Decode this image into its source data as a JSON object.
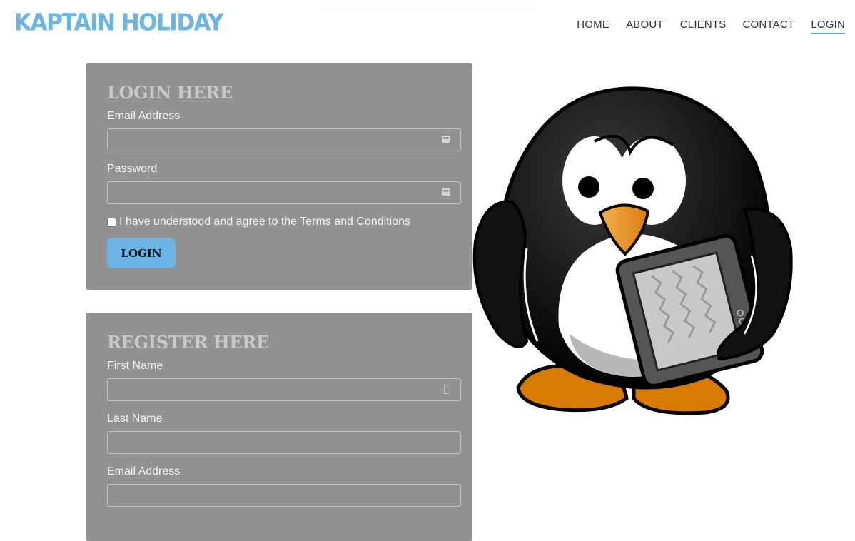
{
  "brand": {
    "logo_text": "KAPTAIN HOLIDAY",
    "accent_color": "#6cb4e4",
    "panel_color": "#929292"
  },
  "nav": {
    "items": [
      {
        "label": "HOME",
        "active": false
      },
      {
        "label": "ABOUT",
        "active": false
      },
      {
        "label": "CLIENTS",
        "active": false
      },
      {
        "label": "CONTACT",
        "active": false
      },
      {
        "label": "LOGIN",
        "active": true
      }
    ]
  },
  "login": {
    "title": "LOGIN HERE",
    "email_label": "Email Address",
    "email_value": "",
    "password_label": "Password",
    "password_value": "",
    "terms_label": "I have understood and agree to the Terms and Conditions",
    "terms_checked": false,
    "submit_label": "LOGIN"
  },
  "register": {
    "title": "REGISTER HERE",
    "first_name_label": "First Name",
    "first_name_value": "",
    "last_name_label": "Last Name",
    "last_name_value": "",
    "email_label": "Email Address",
    "email_value": ""
  },
  "illustration": {
    "icon": "penguin-with-tablet-illustration"
  }
}
